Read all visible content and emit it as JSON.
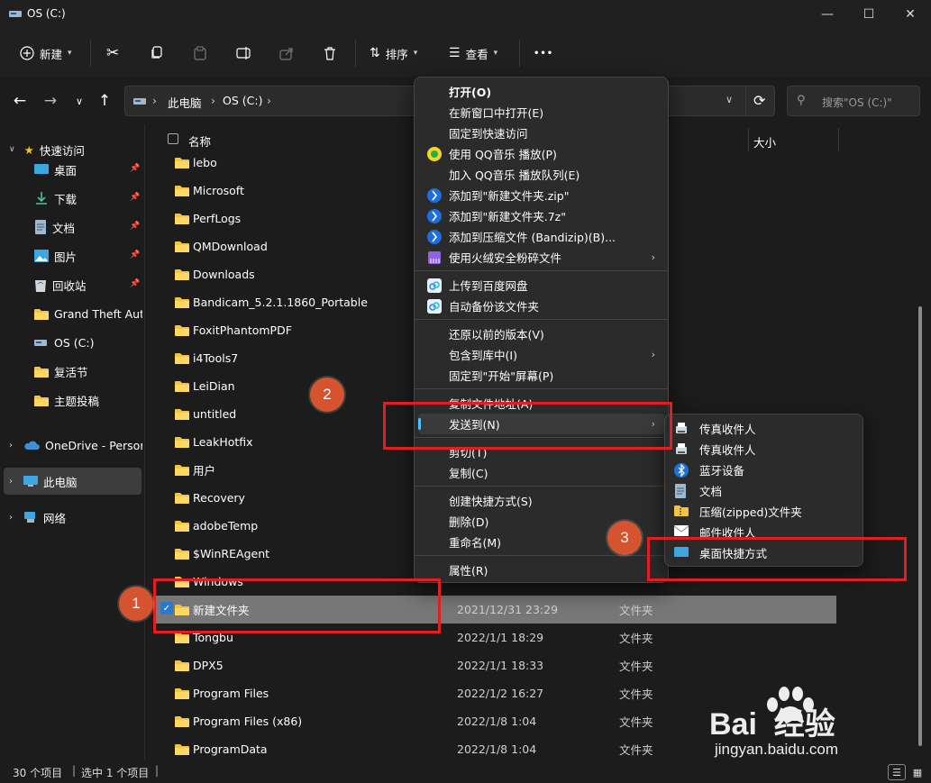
{
  "window": {
    "title": "OS (C:)"
  },
  "toolbar": {
    "new_label": "新建",
    "sort_label": "排序",
    "view_label": "查看",
    "more_label": "•••"
  },
  "address": {
    "crumbs": [
      "此电脑",
      "OS (C:)"
    ],
    "search_placeholder": "搜索\"OS (C:)\""
  },
  "sidebar": {
    "quick_access": "快速访问",
    "items": [
      {
        "label": "桌面",
        "icon": "desktop-icon",
        "pinned": true
      },
      {
        "label": "下载",
        "icon": "download-icon",
        "pinned": true
      },
      {
        "label": "文档",
        "icon": "document-icon",
        "pinned": true
      },
      {
        "label": "图片",
        "icon": "picture-icon",
        "pinned": true
      },
      {
        "label": "回收站",
        "icon": "recycle-bin-icon",
        "pinned": true
      },
      {
        "label": "Grand Theft Auto",
        "icon": "folder-icon"
      },
      {
        "label": "OS (C:)",
        "icon": "drive-icon"
      },
      {
        "label": "复活节",
        "icon": "folder-icon"
      },
      {
        "label": "主题投稿",
        "icon": "folder-icon"
      }
    ],
    "onedrive": "OneDrive - Persor",
    "this_pc": "此电脑",
    "network": "网络"
  },
  "list": {
    "col_name": "名称",
    "col_size": "大小",
    "rows": [
      {
        "name": "lebo"
      },
      {
        "name": "Microsoft"
      },
      {
        "name": "PerfLogs"
      },
      {
        "name": "QMDownload"
      },
      {
        "name": "Downloads"
      },
      {
        "name": "Bandicam_5.2.1.1860_Portable"
      },
      {
        "name": "FoxitPhantomPDF"
      },
      {
        "name": "i4Tools7"
      },
      {
        "name": "LeiDian"
      },
      {
        "name": "untitled"
      },
      {
        "name": "LeakHotfix"
      },
      {
        "name": "用户"
      },
      {
        "name": "Recovery"
      },
      {
        "name": "adobeTemp"
      },
      {
        "name": "$WinREAgent"
      },
      {
        "name": "Windows"
      },
      {
        "name": "新建文件夹",
        "date": "2021/12/31 23:29",
        "type": "文件夹",
        "selected": true
      },
      {
        "name": "Tongbu",
        "date": "2022/1/1 18:29",
        "type": "文件夹"
      },
      {
        "name": "DPX5",
        "date": "2022/1/1 18:33",
        "type": "文件夹"
      },
      {
        "name": "Program Files",
        "date": "2022/1/2 16:27",
        "type": "文件夹"
      },
      {
        "name": "Program Files (x86)",
        "date": "2022/1/8 1:04",
        "type": "文件夹"
      },
      {
        "name": "ProgramData",
        "date": "2022/1/8 1:04",
        "type": "文件夹"
      }
    ]
  },
  "context_menu": {
    "items": [
      {
        "label": "打开(O)",
        "bold": true
      },
      {
        "label": "在新窗口中打开(E)"
      },
      {
        "label": "固定到快速访问"
      },
      {
        "label": "使用 QQ音乐 播放(P)",
        "icon": "qqmusic-icon"
      },
      {
        "label": "加入 QQ音乐 播放队列(E)"
      },
      {
        "label": "添加到\"新建文件夹.zip\"",
        "icon": "bandizip-icon"
      },
      {
        "label": "添加到\"新建文件夹.7z\"",
        "icon": "bandizip-icon"
      },
      {
        "label": "添加到压缩文件 (Bandizip)(B)...",
        "icon": "bandizip-icon"
      },
      {
        "label": "使用火绒安全粉碎文件",
        "icon": "huorong-icon",
        "submenu": true
      },
      {
        "sep": true
      },
      {
        "label": "上传到百度网盘",
        "icon": "baidu-netdisk-icon"
      },
      {
        "label": "自动备份该文件夹",
        "icon": "baidu-netdisk-icon"
      },
      {
        "sep": true
      },
      {
        "label": "还原以前的版本(V)"
      },
      {
        "label": "包含到库中(I)",
        "submenu": true
      },
      {
        "label": "固定到\"开始\"屏幕(P)"
      },
      {
        "sep": true
      },
      {
        "label": "复制文件地址(A)"
      },
      {
        "label": "发送到(N)",
        "submenu": true,
        "highlighted": true
      },
      {
        "sep": true
      },
      {
        "label": "剪切(T)"
      },
      {
        "label": "复制(C)"
      },
      {
        "sep": true
      },
      {
        "label": "创建快捷方式(S)"
      },
      {
        "label": "删除(D)"
      },
      {
        "label": "重命名(M)"
      },
      {
        "sep": true
      },
      {
        "label": "属性(R)"
      }
    ]
  },
  "sendto_menu": {
    "items": [
      {
        "label": "传真收件人",
        "icon": "fax-icon"
      },
      {
        "label": "传真收件人",
        "icon": "fax-icon"
      },
      {
        "label": "蓝牙设备",
        "icon": "bluetooth-icon"
      },
      {
        "label": "文档",
        "icon": "document-icon"
      },
      {
        "label": "压缩(zipped)文件夹",
        "icon": "zip-folder-icon"
      },
      {
        "label": "邮件收件人",
        "icon": "mail-icon"
      },
      {
        "label": "桌面快捷方式",
        "icon": "desktop-icon"
      }
    ]
  },
  "annotations": [
    "1",
    "2",
    "3"
  ],
  "status": {
    "count": "30 个项目",
    "selected": "选中 1 个项目"
  },
  "watermark": {
    "brand": "Bai  经验",
    "url": "jingyan.baidu.com"
  }
}
